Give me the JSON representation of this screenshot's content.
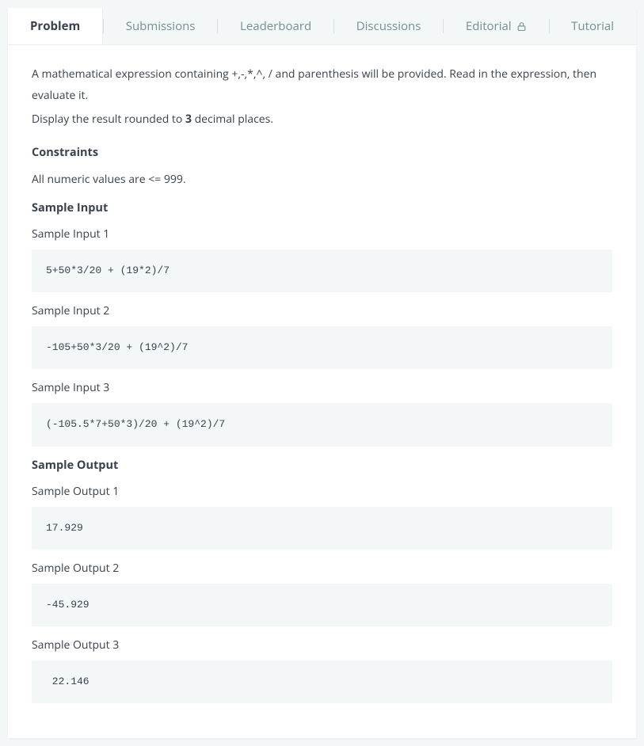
{
  "tabs": [
    {
      "label": "Problem",
      "active": true
    },
    {
      "label": "Submissions",
      "active": false
    },
    {
      "label": "Leaderboard",
      "active": false
    },
    {
      "label": "Discussions",
      "active": false
    },
    {
      "label": "Editorial",
      "active": false,
      "locked": true
    },
    {
      "label": "Tutorial",
      "active": false
    }
  ],
  "description": {
    "line1": "A mathematical expression containing +,-,*,^, / and parenthesis will be provided. Read in the expression, then evaluate it.",
    "line2_pre": "Display the result rounded to ",
    "line2_bold": "3",
    "line2_post": " decimal places."
  },
  "constraints": {
    "heading": "Constraints",
    "text": "All numeric values are <= 999."
  },
  "sample_input": {
    "heading": "Sample Input",
    "items": [
      {
        "label": "Sample Input 1",
        "code": "5+50*3/20 + (19*2)/7"
      },
      {
        "label": "Sample Input 2",
        "code": "-105+50*3/20 + (19^2)/7"
      },
      {
        "label": "Sample Input 3",
        "code": "(-105.5*7+50*3)/20 + (19^2)/7"
      }
    ]
  },
  "sample_output": {
    "heading": "Sample Output",
    "items": [
      {
        "label": "Sample Output 1",
        "code": "17.929"
      },
      {
        "label": "Sample Output 2",
        "code": "-45.929"
      },
      {
        "label": "Sample Output 3",
        "code": " 22.146"
      }
    ]
  }
}
